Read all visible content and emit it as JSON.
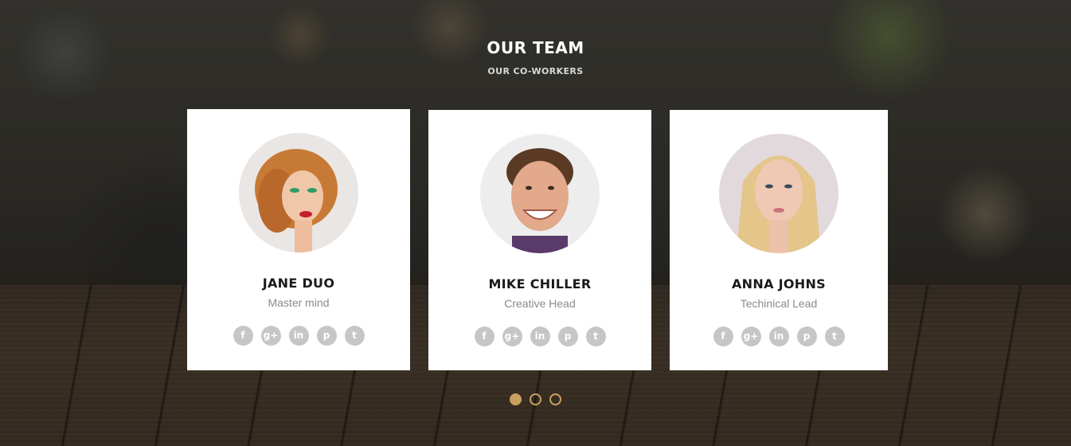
{
  "section": {
    "title": "OUR TEAM",
    "subtitle": "OUR CO-WORKERS"
  },
  "team": [
    {
      "name": "JANE DUO",
      "role": "Master mind",
      "socials": [
        {
          "icon": "facebook-icon",
          "glyph": "f"
        },
        {
          "icon": "google-plus-icon",
          "glyph": "g+"
        },
        {
          "icon": "linkedin-icon",
          "glyph": "in"
        },
        {
          "icon": "pinterest-icon",
          "glyph": "p"
        },
        {
          "icon": "twitter-icon",
          "glyph": "t"
        }
      ]
    },
    {
      "name": "MIKE CHILLER",
      "role": "Creative Head",
      "socials": [
        {
          "icon": "facebook-icon",
          "glyph": "f"
        },
        {
          "icon": "google-plus-icon",
          "glyph": "g+"
        },
        {
          "icon": "linkedin-icon",
          "glyph": "in"
        },
        {
          "icon": "pinterest-icon",
          "glyph": "p"
        },
        {
          "icon": "twitter-icon",
          "glyph": "t"
        }
      ]
    },
    {
      "name": "ANNA JOHNS",
      "role": "Techinical Lead",
      "socials": [
        {
          "icon": "facebook-icon",
          "glyph": "f"
        },
        {
          "icon": "google-plus-icon",
          "glyph": "g+"
        },
        {
          "icon": "linkedin-icon",
          "glyph": "in"
        },
        {
          "icon": "pinterest-icon",
          "glyph": "p"
        },
        {
          "icon": "twitter-icon",
          "glyph": "t"
        }
      ]
    }
  ],
  "carousel": {
    "pages": 3,
    "active_index": 0
  },
  "colors": {
    "accent": "#c8a160",
    "card_bg": "#ffffff",
    "social_bg": "#c6c6c6"
  }
}
